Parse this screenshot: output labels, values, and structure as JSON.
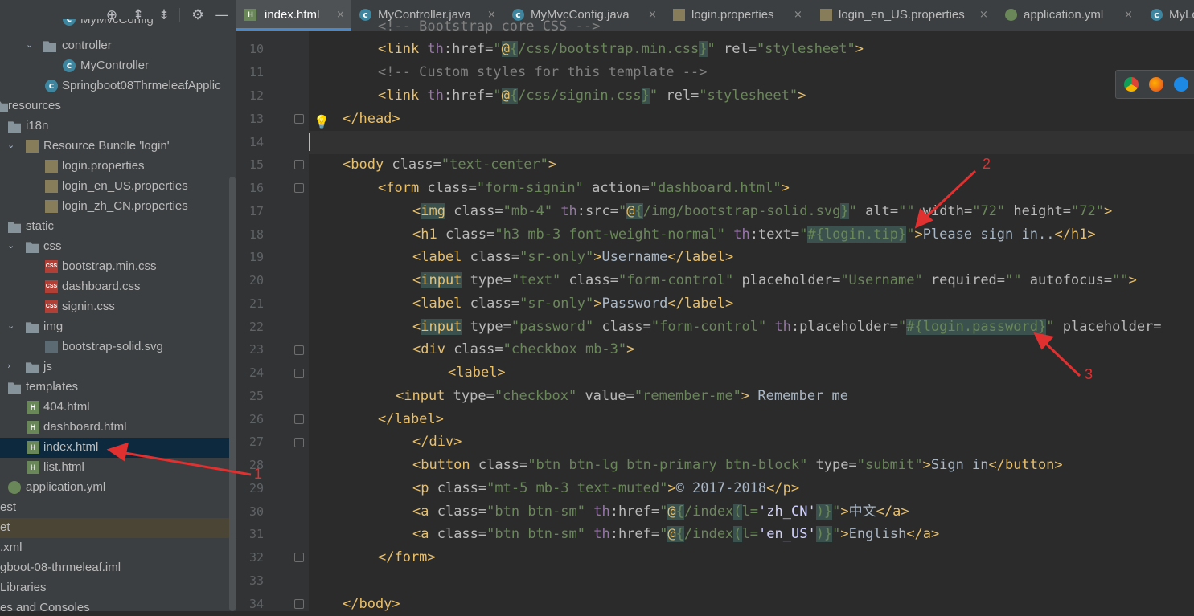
{
  "sidebar": {
    "toolbar_icons": [
      "crosshair-icon",
      "expand-all-icon",
      "collapse-all-icon",
      "gear-icon",
      "minimize-icon"
    ],
    "items": [
      {
        "label": "MyMvcConfig",
        "icon": "class-icon"
      },
      {
        "label": "controller",
        "icon": "folder-icon"
      },
      {
        "label": "MyController",
        "icon": "class-icon"
      },
      {
        "label": "Springboot08ThrmeleafApplic",
        "icon": "class-icon"
      },
      {
        "label": "resources",
        "icon": "folder-icon"
      },
      {
        "label": "i18n",
        "icon": "folder-icon"
      },
      {
        "label": "Resource Bundle 'login'",
        "icon": "bundle-icon"
      },
      {
        "label": "login.properties",
        "icon": "properties-icon"
      },
      {
        "label": "login_en_US.properties",
        "icon": "properties-icon"
      },
      {
        "label": "login_zh_CN.properties",
        "icon": "properties-icon"
      },
      {
        "label": "static",
        "icon": "folder-icon"
      },
      {
        "label": "css",
        "icon": "folder-icon"
      },
      {
        "label": "bootstrap.min.css",
        "icon": "css-icon"
      },
      {
        "label": "dashboard.css",
        "icon": "css-icon"
      },
      {
        "label": "signin.css",
        "icon": "css-icon"
      },
      {
        "label": "img",
        "icon": "folder-icon"
      },
      {
        "label": "bootstrap-solid.svg",
        "icon": "svg-icon"
      },
      {
        "label": "js",
        "icon": "folder-icon"
      },
      {
        "label": "templates",
        "icon": "folder-icon"
      },
      {
        "label": "404.html",
        "icon": "html-icon"
      },
      {
        "label": "dashboard.html",
        "icon": "html-icon"
      },
      {
        "label": "index.html",
        "icon": "html-icon"
      },
      {
        "label": "list.html",
        "icon": "html-icon"
      },
      {
        "label": "application.yml",
        "icon": "yml-icon"
      },
      {
        "label": "est",
        "icon": ""
      },
      {
        "label": "et",
        "icon": ""
      },
      {
        "label": ".xml",
        "icon": ""
      },
      {
        "label": "gboot-08-thrmeleaf.iml",
        "icon": ""
      },
      {
        "label": "Libraries",
        "icon": ""
      },
      {
        "label": "es and Consoles",
        "icon": ""
      }
    ]
  },
  "tabs": [
    {
      "label": "index.html",
      "close": "×"
    },
    {
      "label": "MyController.java",
      "close": "×"
    },
    {
      "label": "MyMvcConfig.java",
      "close": "×"
    },
    {
      "label": "login.properties",
      "close": "×"
    },
    {
      "label": "login_en_US.properties",
      "close": "×"
    },
    {
      "label": "application.yml",
      "close": "×"
    },
    {
      "label": "MyLo",
      "close": ""
    }
  ],
  "editor": {
    "line_numbers": [
      "10",
      "11",
      "12",
      "13",
      "14",
      "15",
      "16",
      "17",
      "18",
      "19",
      "20",
      "21",
      "22",
      "23",
      "24",
      "25",
      "26",
      "27",
      "28",
      "29",
      "30",
      "31",
      "32",
      "33",
      "34"
    ],
    "first_partial_line": "<!-- Bootstrap core CSS -->"
  },
  "annotations": [
    "1",
    "2",
    "3"
  ],
  "colors": {
    "accent": "#4a88c7",
    "annotation": "#e03030",
    "tag": "#e8bf6a",
    "string": "#6a8759",
    "comment": "#808080"
  }
}
